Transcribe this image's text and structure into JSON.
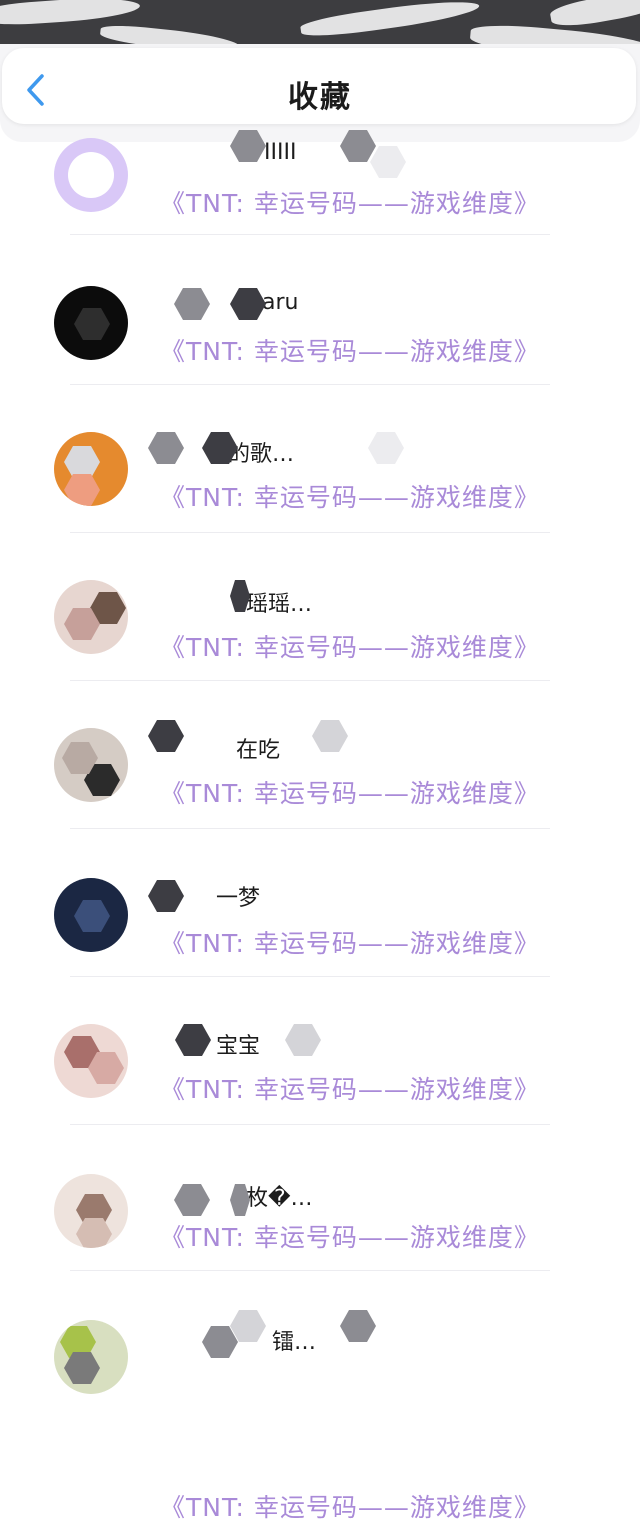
{
  "header": {
    "title": "收藏",
    "back_label": "<"
  },
  "colors": {
    "accent_song": "#a98ad8",
    "back_icon": "#3f99ee",
    "status_bg": "#3d3d40"
  },
  "favorites": [
    {
      "user": "IIIII",
      "song": "《TNT: 幸运号码——游戏维度》",
      "avatar_colors": [
        "#d9c8f7",
        "#a68ce8",
        "#ede6fb"
      ]
    },
    {
      "user": "aru",
      "song": "《TNT: 幸运号码——游戏维度》",
      "avatar_colors": [
        "#0c0c0c",
        "#2a2a2a",
        "#444444"
      ]
    },
    {
      "user": "的歌…",
      "song": "《TNT: 幸运号码——游戏维度》",
      "avatar_colors": [
        "#e58a2e",
        "#ee9d80",
        "#d9d9dc"
      ]
    },
    {
      "user": "瑶瑶…",
      "song": "《TNT: 幸运号码——游戏维度》",
      "avatar_colors": [
        "#6e5548",
        "#c6a09a",
        "#e7d6d0"
      ]
    },
    {
      "user": "在吃",
      "song": "《TNT: 幸运号码——游戏维度》",
      "avatar_colors": [
        "#2b2b2b",
        "#b8aaa3",
        "#d5ccc5"
      ]
    },
    {
      "user": "一梦",
      "song": "《TNT: 幸运号码——游戏维度》",
      "avatar_colors": [
        "#1b2743",
        "#3b4f7a",
        "#8a98b4"
      ]
    },
    {
      "user": "宝宝",
      "song": "《TNT: 幸运号码——游戏维度》",
      "avatar_colors": [
        "#a96f6b",
        "#d7aaa4",
        "#eed9d4"
      ]
    },
    {
      "user": "枚�…",
      "song": "《TNT: 幸运号码——游戏维度》",
      "avatar_colors": [
        "#9a7a6d",
        "#d5bdb3",
        "#eee3dd"
      ]
    },
    {
      "user": "镭…",
      "song": "《TNT: 幸运号码——游戏维度》",
      "avatar_colors": [
        "#a7c24a",
        "#7a7a7a",
        "#d8dfc0"
      ]
    }
  ]
}
